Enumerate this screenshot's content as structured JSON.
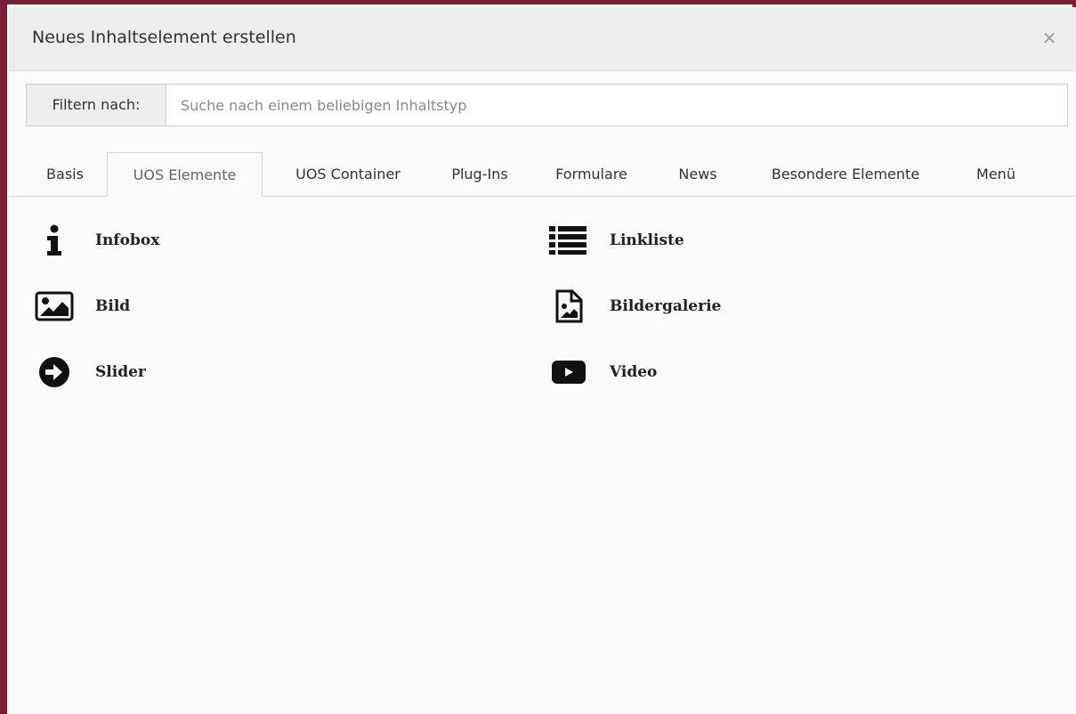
{
  "modal": {
    "title": "Neues Inhaltselement erstellen",
    "close_label": "×"
  },
  "filter": {
    "label": "Filtern nach:",
    "placeholder": "Suche nach einem beliebigen Inhaltstyp",
    "value": ""
  },
  "tabs": [
    {
      "label": "Basis",
      "active": false
    },
    {
      "label": "UOS Elemente",
      "active": true
    },
    {
      "label": "UOS Container",
      "active": false
    },
    {
      "label": "Plug-Ins",
      "active": false
    },
    {
      "label": "Formulare",
      "active": false
    },
    {
      "label": "News",
      "active": false
    },
    {
      "label": "Besondere Elemente",
      "active": false
    },
    {
      "label": "Menü",
      "active": false
    }
  ],
  "items": [
    {
      "label": "Infobox",
      "icon": "info-icon"
    },
    {
      "label": "Linkliste",
      "icon": "list-icon"
    },
    {
      "label": "Bild",
      "icon": "image-icon"
    },
    {
      "label": "Bildergalerie",
      "icon": "image-file-icon"
    },
    {
      "label": "Slider",
      "icon": "arrow-circle-right-icon"
    },
    {
      "label": "Video",
      "icon": "youtube-play-icon"
    }
  ],
  "colors": {
    "frame": "#7a1e34",
    "header_bg": "#ededed",
    "body_bg": "#fafafa"
  }
}
